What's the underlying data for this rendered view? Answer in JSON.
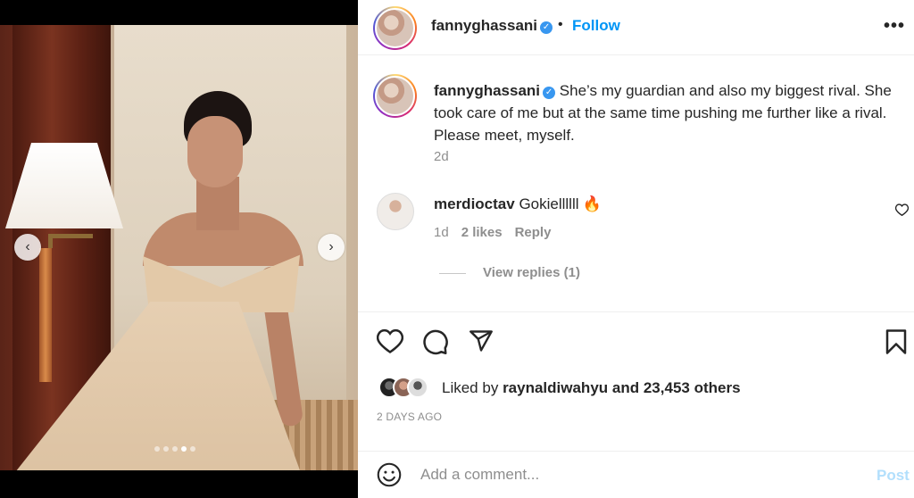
{
  "post": {
    "username": "fannyghassani",
    "verified_mark": "✓",
    "follow_label": "Follow",
    "separator": "•",
    "more_label": "•••"
  },
  "caption": {
    "username": "fannyghassani",
    "text": "She’s my guardian and also my biggest rival. She took care of me but at the same time pushing me further like a rival. Please meet, myself.",
    "time": "2d"
  },
  "comment": {
    "username": "merdioctav",
    "text": "Gokiellllll",
    "emoji": "🔥",
    "time": "1d",
    "likes": "2 likes",
    "reply_label": "Reply",
    "view_replies": "View replies (1)"
  },
  "likes": {
    "prefix": "Liked by",
    "user": "raynaldiwahyu",
    "others": "and 23,453 others"
  },
  "post_time": "2 DAYS AGO",
  "add_comment": {
    "placeholder": "Add a comment...",
    "post_label": "Post"
  },
  "carousel": {
    "prev": "‹",
    "next": "›",
    "slide_count": 5,
    "active_slide": 4
  },
  "icons": {
    "like": "heart-icon",
    "comment": "comment-icon",
    "share": "share-icon",
    "save": "bookmark-icon",
    "emoji": "smile-icon",
    "more": "more-icon"
  },
  "colors": {
    "accent": "#0095f6",
    "muted": "#8e8e8e",
    "post_disabled": "#b2dffc",
    "verified": "#3897f0"
  }
}
